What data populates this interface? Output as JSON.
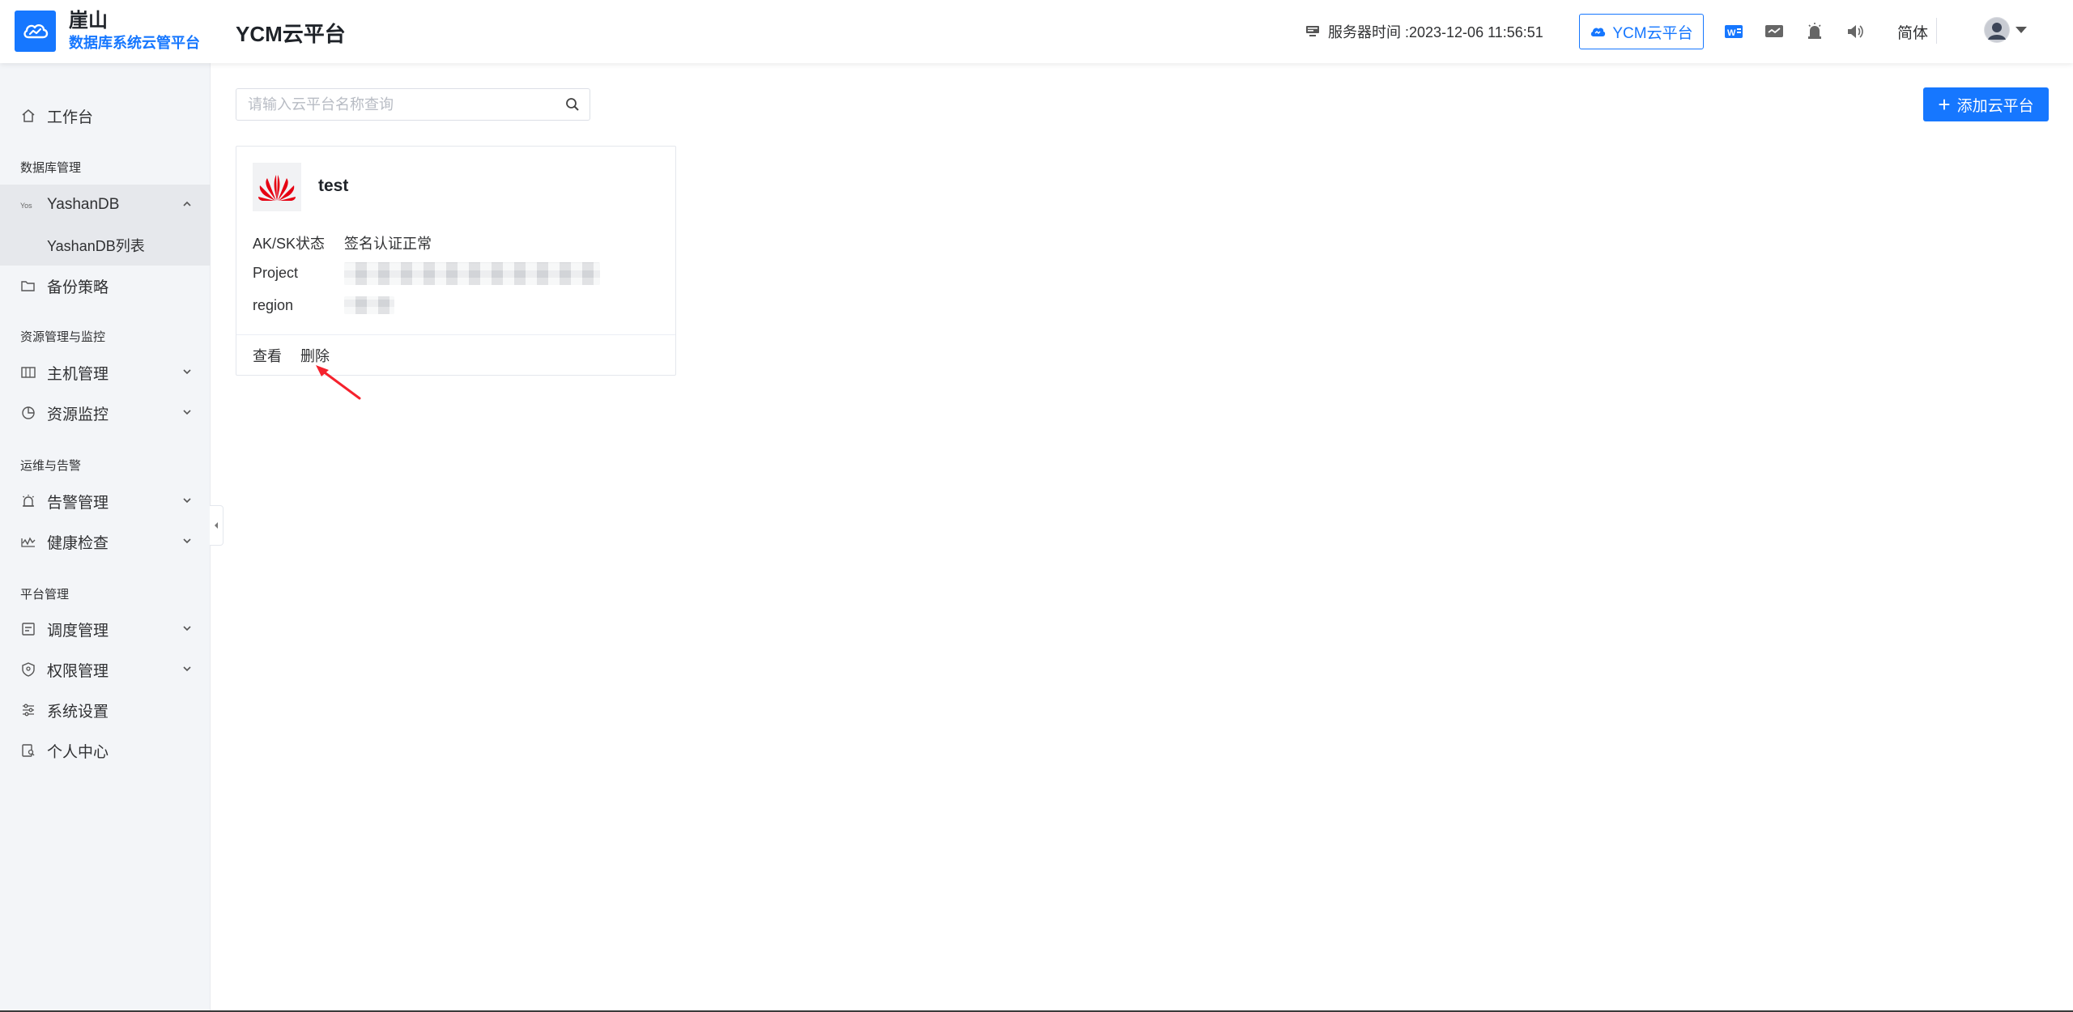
{
  "brand": {
    "name": "崖山",
    "subtitle": "数据库系统云管平台"
  },
  "page_title": "YCM云平台",
  "header": {
    "server_time_label": "服务器时间 :2023-12-06 11:56:51",
    "platform_button": "YCM云平台",
    "language": "简体",
    "icons": [
      "word-doc-icon",
      "screen-icon",
      "alarm-bell-icon",
      "speaker-icon",
      "user-avatar",
      "caret-down-icon"
    ]
  },
  "sidebar": {
    "workbench": "工作台",
    "group_db": "数据库管理",
    "yashandb": "YashanDB",
    "yashandb_list": "YashanDB列表",
    "backup": "备份策略",
    "group_resource": "资源管理与监控",
    "host": "主机管理",
    "monitor": "资源监控",
    "group_ops": "运维与告警",
    "alarm": "告警管理",
    "health": "健康检查",
    "group_platform": "平台管理",
    "schedule": "调度管理",
    "permission": "权限管理",
    "settings": "系统设置",
    "personal": "个人中心"
  },
  "search": {
    "placeholder": "请输入云平台名称查询",
    "value": ""
  },
  "add_button": "添加云平台",
  "card": {
    "title": "test",
    "fields": [
      {
        "label": "AK/SK状态",
        "value": "签名认证正常"
      },
      {
        "label": "Project",
        "value": ""
      },
      {
        "label": "region",
        "value": ""
      }
    ],
    "actions": {
      "view": "查看",
      "delete": "删除"
    }
  },
  "colors": {
    "primary": "#1677ff",
    "sidebar_bg": "#f3f5f8",
    "huawei_red": "#e60012",
    "arrow_red": "#f5222d"
  }
}
